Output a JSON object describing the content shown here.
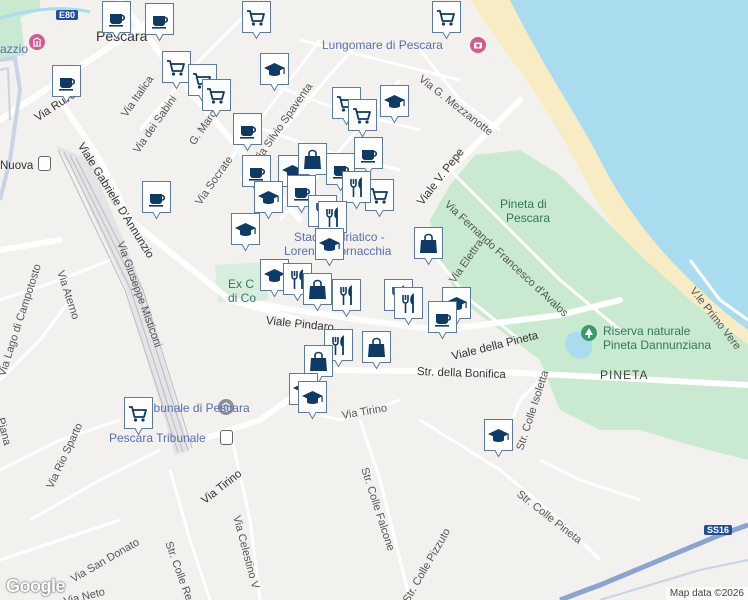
{
  "map": {
    "attribution": "Map data ©2026",
    "logo_text": "Google",
    "colors": {
      "water": "#a9dcef",
      "beach": "#f7ecc3",
      "park": "#c9e9d0",
      "land": "#f2f1ee",
      "road": "#ffffff",
      "highway": "#8aa4cf",
      "rail": "#b8bcc2",
      "pin_fill": "#0d3b66",
      "pin_bg": "#ffffff"
    },
    "labels": {
      "lungomare": "Lungomare di Pescara",
      "pineta_pescara": "Pineta di\nPescara",
      "pineta_pescara_l1": "Pineta di",
      "pineta_pescara_l2": "Pescara",
      "riserva": "Riserva naturale",
      "riserva2": "Pineta Dannunziana",
      "pineta": "PINETA",
      "tribunale": "Tribunale di Pescara",
      "pescara_tribunale": "Pescara Tribunale",
      "stadio_1": "Stadio Adriatico -",
      "stadio_2": "Lorenzo Cornacchia",
      "ex_c": "Ex C",
      "di_c": "di Co",
      "pescara_top": "Pescara",
      "nuova": "Nuova",
      "azzio": "azzio",
      "via_ruvo": "Via Ruvo",
      "viale_dannunzio": "Viale Gabriele D'Annunzio",
      "via_misticoni": "Via Giuseppe Misticoni",
      "via_aterno": "Via Aterno",
      "via_lago": "Via Lago di Campotosto",
      "viale_pindaro": "Viale Pindaro",
      "viale_pepe": "Viale V. Pepe",
      "via_avalos": "Via Fernando Francesco d'Avalos",
      "via_elettra": "Via Elettra",
      "viale_pineta": "Viale della Pineta",
      "str_bonifica": "Str. della Bonifica",
      "via_tirino_1": "Via Tirino",
      "via_tirino_2": "Via Tirino",
      "via_rio_sparto": "Via Rio Sparto",
      "via_san_donato": "Via San Donato",
      "via_neto": "Via Neto",
      "str_colle_renazzo": "Str. Colle Renazzo",
      "via_celestino": "Via Celestino V",
      "str_colle_falcone": "Str. Colle Falcone",
      "str_colle_pizzuto": "Str. Colle Pizzuto",
      "str_colle_isoletta": "Str. Colle Isoletta",
      "str_colle_pineta": "Str. Colle Pineta",
      "via_mezzanotte": "Via G. Mezzanotte",
      "via_italica": "Via Italica",
      "via_dei_sabini": "Via dei Sabini",
      "via_socrate": "Via Socrate",
      "via_spaventa": "Via Silvio Spaventa",
      "marconi": "G. Marconi",
      "viale_primo_vere": "V.le Primo Vere",
      "via_ec": "Via E",
      "viana": "Piana",
      "s_label": "S",
      "e80": "E80",
      "ss16": "SS16"
    },
    "markers": [
      {
        "type": "coffee",
        "name": "coffee-marker-1"
      },
      {
        "type": "coffee",
        "name": "coffee-marker-2"
      },
      {
        "type": "shopping-cart",
        "name": "cart-marker-1"
      },
      {
        "type": "shopping-cart",
        "name": "cart-marker-2"
      },
      {
        "type": "coffee",
        "name": "coffee-marker-3"
      },
      {
        "type": "shopping-cart",
        "name": "cart-marker-3"
      },
      {
        "type": "shopping-cart",
        "name": "cart-marker-4"
      },
      {
        "type": "shopping-cart",
        "name": "cart-marker-5"
      },
      {
        "type": "school",
        "name": "school-marker-1"
      },
      {
        "type": "shopping-cart",
        "name": "cart-marker-6"
      },
      {
        "type": "shopping-cart",
        "name": "cart-marker-7"
      },
      {
        "type": "school",
        "name": "school-marker-2"
      },
      {
        "type": "coffee",
        "name": "coffee-marker-4"
      },
      {
        "type": "coffee",
        "name": "coffee-marker-5"
      },
      {
        "type": "coffee",
        "name": "coffee-marker-6"
      },
      {
        "type": "school",
        "name": "school-marker-3"
      },
      {
        "type": "shopping-bag",
        "name": "bag-marker-1"
      },
      {
        "type": "coffee",
        "name": "coffee-marker-7"
      },
      {
        "type": "coffee",
        "name": "coffee-marker-8"
      },
      {
        "type": "school",
        "name": "school-marker-4"
      },
      {
        "type": "restaurant",
        "name": "restaurant-marker-1"
      },
      {
        "type": "shopping-cart",
        "name": "cart-marker-8"
      },
      {
        "type": "coffee",
        "name": "coffee-marker-9"
      },
      {
        "type": "restaurant",
        "name": "restaurant-marker-2"
      },
      {
        "type": "restaurant",
        "name": "restaurant-marker-3"
      },
      {
        "type": "school",
        "name": "school-marker-5"
      },
      {
        "type": "school",
        "name": "school-marker-6"
      },
      {
        "type": "shopping-bag",
        "name": "bag-marker-2"
      },
      {
        "type": "school",
        "name": "school-marker-7"
      },
      {
        "type": "restaurant",
        "name": "restaurant-marker-4"
      },
      {
        "type": "shopping-bag",
        "name": "bag-marker-3"
      },
      {
        "type": "restaurant",
        "name": "restaurant-marker-5"
      },
      {
        "type": "restaurant",
        "name": "restaurant-marker-6"
      },
      {
        "type": "restaurant",
        "name": "restaurant-marker-7"
      },
      {
        "type": "school",
        "name": "school-marker-8"
      },
      {
        "type": "coffee",
        "name": "coffee-marker-10"
      },
      {
        "type": "restaurant",
        "name": "restaurant-marker-8"
      },
      {
        "type": "shopping-bag",
        "name": "bag-marker-4"
      },
      {
        "type": "shopping-bag",
        "name": "bag-marker-5"
      },
      {
        "type": "school",
        "name": "school-marker-9"
      },
      {
        "type": "school",
        "name": "school-marker-10"
      },
      {
        "type": "shopping-cart",
        "name": "cart-marker-9"
      },
      {
        "type": "school",
        "name": "school-marker-11"
      }
    ]
  }
}
